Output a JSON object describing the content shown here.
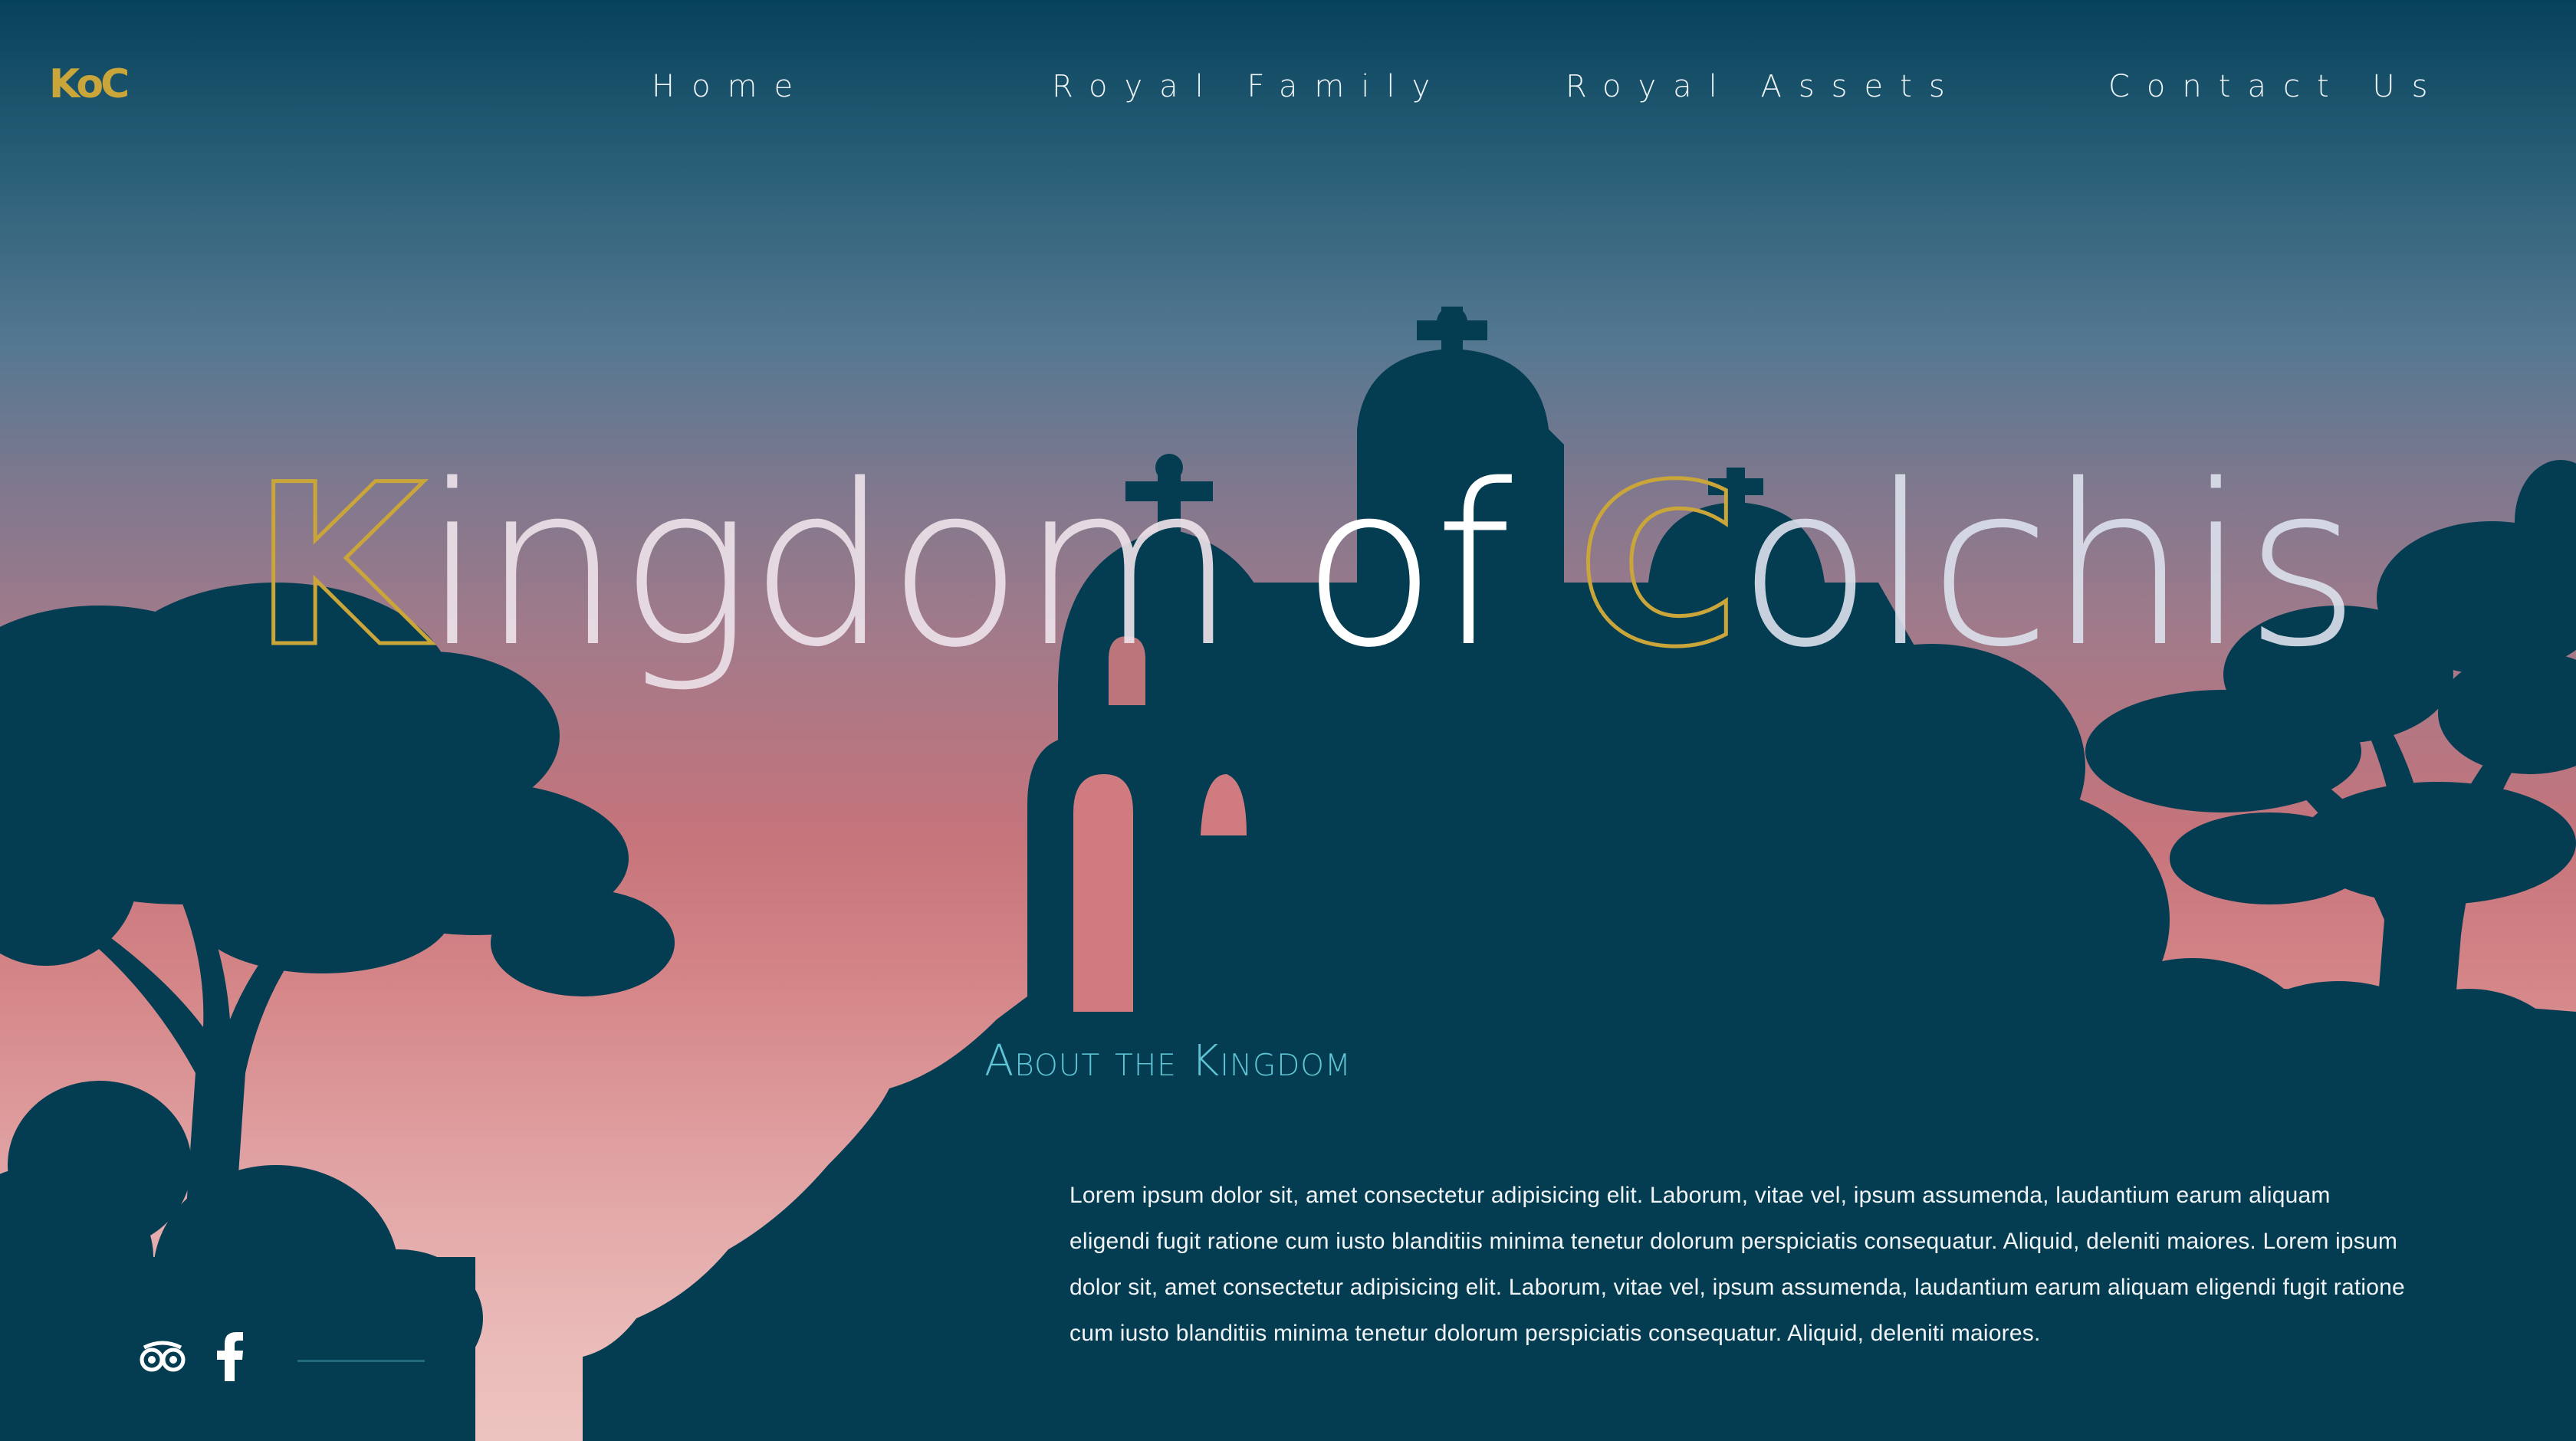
{
  "brand": {
    "logo_text": "KoC",
    "accent_color": "#c9a53a"
  },
  "nav": {
    "items": [
      {
        "label": "Home"
      },
      {
        "label": "Royal Family"
      },
      {
        "label": "Royal Assets"
      },
      {
        "label": "Contact Us"
      }
    ]
  },
  "hero": {
    "title_word1_cap": "K",
    "title_word1_rest": "ingdom",
    "title_word2": "of",
    "title_word3_cap": "C",
    "title_word3_rest": "olchis"
  },
  "about": {
    "heading": "About the Kingdom",
    "body": "Lorem ipsum dolor sit, amet consectetur adipisicing elit. Laborum, vitae vel, ipsum assumenda, laudantium earum aliquam eligendi fugit ratione cum iusto blanditiis minima tenetur dolorum perspiciatis consequatur. Aliquid, deleniti maiores. Lorem ipsum dolor sit, amet consectetur adipisicing elit. Laborum, vitae vel, ipsum assumenda, laudantium earum aliquam eligendi fugit ratione cum iusto blanditiis minima tenetur dolorum perspiciatis consequatur. Aliquid, deleniti maiores."
  },
  "social": {
    "icons": [
      "tripadvisor-icon",
      "facebook-icon"
    ]
  },
  "colors": {
    "silhouette": "#043d52",
    "heading_accent": "#5fc4d4"
  }
}
